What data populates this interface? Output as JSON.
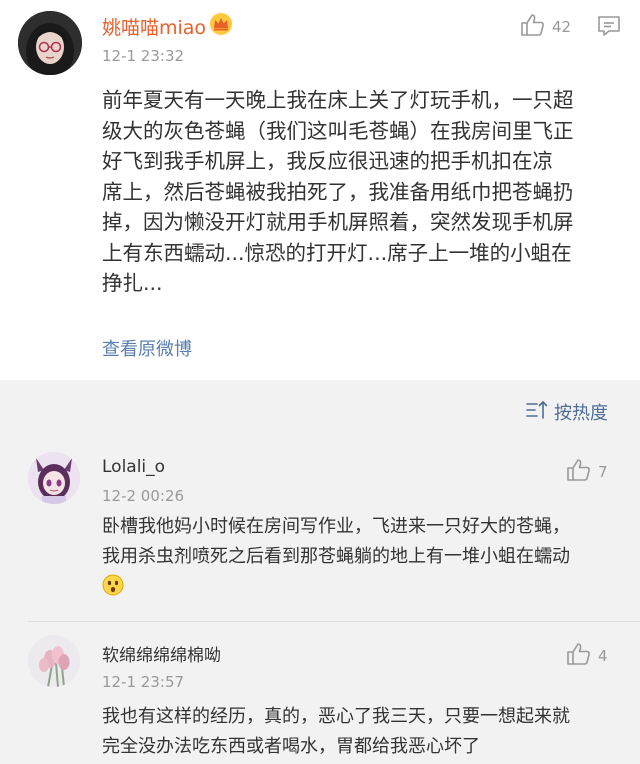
{
  "main_comment": {
    "username": "姚喵喵miao",
    "time": "12-1 23:32",
    "likes": "42",
    "text": "前年夏天有一天晚上我在床上关了灯玩手机，一只超\n级大的灰色苍蝇（我们这叫毛苍蝇）在我房间里飞正\n好飞到我手机屏上，我反应很迅速的把手机扣在凉\n席上，然后苍蝇被我拍死了，我准备用纸巾把苍蝇扔\n掉，因为懒没开灯就用手机屏照着，突然发现手机屏\n上有东西蠕动...惊恐的打开灯...席子上一堆的小蛆在\n挣扎...",
    "link": "查看原微博"
  },
  "sort_label": "按热度",
  "replies": [
    {
      "username": "Lolali_o",
      "time": "12-2 00:26",
      "likes": "7",
      "text": "卧槽我他妈小时候在房间写作业，飞进来一只好大的苍蝇，\n我用杀虫剂喷死之后看到那苍蝇躺的地上有一堆小蛆在蠕动"
    },
    {
      "username": "软绵绵绵绵棉呦",
      "time": "12-1 23:57",
      "likes": "4",
      "text": "我也有这样的经历，真的，恶心了我三天，只要一想起来就\n完全没办法吃东西或者喝水，胃都给我恶心坏了"
    }
  ],
  "colors": {
    "vip_name": "#e8602a",
    "link": "#5a7fb0",
    "background": "#f2f2f2"
  }
}
